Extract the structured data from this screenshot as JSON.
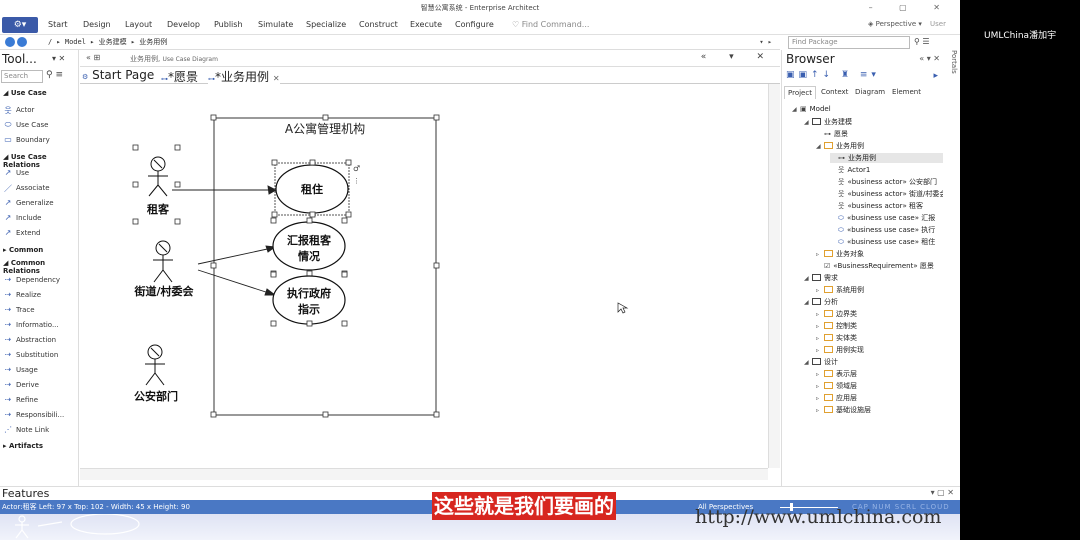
{
  "window": {
    "title": "智慧公寓系统 - Enterprise Architect",
    "controls": "– ▢ ✕"
  },
  "menu": {
    "items": [
      "Start",
      "Design",
      "Layout",
      "Develop",
      "Publish",
      "Simulate",
      "Specialize",
      "Construct",
      "Execute",
      "Configure"
    ],
    "find_command": "Find Command...",
    "perspective": "Perspective",
    "user": "User"
  },
  "nav": {
    "breadcrumb": [
      "/",
      "Model",
      "业务建模",
      "业务用例"
    ],
    "find_package_placeholder": "Find Package"
  },
  "toolbox": {
    "title": "Tool...",
    "search_placeholder": "Search",
    "sections": [
      {
        "name": "Use Case",
        "items": [
          "Actor",
          "Use Case",
          "Boundary"
        ]
      },
      {
        "name": "Use Case Relations",
        "items": [
          "Use",
          "Associate",
          "Generalize",
          "Include",
          "Extend"
        ]
      },
      {
        "name": "Common",
        "items": []
      },
      {
        "name": "Common Relations",
        "items": [
          "Dependency",
          "Realize",
          "Trace",
          "Informatio...",
          "Abstraction",
          "Substitution",
          "Usage",
          "Derive",
          "Refine",
          "Responsibili...",
          "Note Link"
        ]
      },
      {
        "name": "Artifacts",
        "items": []
      }
    ]
  },
  "document": {
    "header_name": "业务用例,",
    "header_type": "Use Case Diagram",
    "tabs": [
      "Start Page",
      "*愿景",
      "*业务用例"
    ]
  },
  "diagram": {
    "boundary_title": "A公寓管理机构",
    "actors": [
      "租客",
      "街道/村委会",
      "公安部门"
    ],
    "use_cases": [
      "租住",
      "汇报租客\n情况",
      "执行政府\n指示"
    ],
    "use_case_lines": [
      [
        "租住"
      ],
      [
        "汇报租客",
        "情况"
      ],
      [
        "执行政府",
        "指示"
      ]
    ]
  },
  "browser": {
    "title": "Browser",
    "tabs": [
      "Project",
      "Context",
      "Diagram",
      "Element"
    ],
    "tree": [
      {
        "label": "Model",
        "level": 0,
        "icon": "model"
      },
      {
        "label": "业务建模",
        "level": 1,
        "icon": "pkg"
      },
      {
        "label": "愿景",
        "level": 2,
        "icon": "diagram"
      },
      {
        "label": "业务用例",
        "level": 2,
        "icon": "folder"
      },
      {
        "label": "业务用例",
        "level": 3,
        "icon": "diagram",
        "selected": true
      },
      {
        "label": "Actor1",
        "level": 3,
        "icon": "actor"
      },
      {
        "label": "«business actor» 公安部门",
        "level": 3,
        "icon": "actor"
      },
      {
        "label": "«business actor» 街道/村委会",
        "level": 3,
        "icon": "actor"
      },
      {
        "label": "«business actor» 租客",
        "level": 3,
        "icon": "actor"
      },
      {
        "label": "«business use case» 汇报",
        "level": 3,
        "icon": "usecase"
      },
      {
        "label": "«business use case» 执行",
        "level": 3,
        "icon": "usecase"
      },
      {
        "label": "«business use case» 租住",
        "level": 3,
        "icon": "usecase"
      },
      {
        "label": "业务对象",
        "level": 2,
        "icon": "folder"
      },
      {
        "label": "«BusinessRequirement» 愿景",
        "level": 2,
        "icon": "check"
      },
      {
        "label": "需求",
        "level": 1,
        "icon": "pkg"
      },
      {
        "label": "系统用例",
        "level": 2,
        "icon": "folder"
      },
      {
        "label": "分析",
        "level": 1,
        "icon": "pkg"
      },
      {
        "label": "边界类",
        "level": 2,
        "icon": "folder"
      },
      {
        "label": "控制类",
        "level": 2,
        "icon": "folder"
      },
      {
        "label": "实体类",
        "level": 2,
        "icon": "folder"
      },
      {
        "label": "用例实现",
        "level": 2,
        "icon": "folder"
      },
      {
        "label": "设计",
        "level": 1,
        "icon": "pkg"
      },
      {
        "label": "表示层",
        "level": 2,
        "icon": "folder"
      },
      {
        "label": "领域层",
        "level": 2,
        "icon": "folder"
      },
      {
        "label": "应用层",
        "level": 2,
        "icon": "folder"
      },
      {
        "label": "基础设施层",
        "level": 2,
        "icon": "folder"
      }
    ],
    "side_label": "Portals"
  },
  "features": {
    "title": "Features"
  },
  "status": {
    "left": "Actor:租客    Left:   97 x Top:   102 - Width:   45 x Height:   90",
    "right": "All Perspectives",
    "modes": "CAP  NUM  SCRL  CLOUD"
  },
  "caption": "这些就是我们要画的",
  "url": "http://www.umlchina.com",
  "watermark": "UMLChina潘加宇",
  "colors": {
    "accent": "#3b5aa8",
    "status_bar": "#4a78c4",
    "caption_bg": "#d7261f"
  }
}
